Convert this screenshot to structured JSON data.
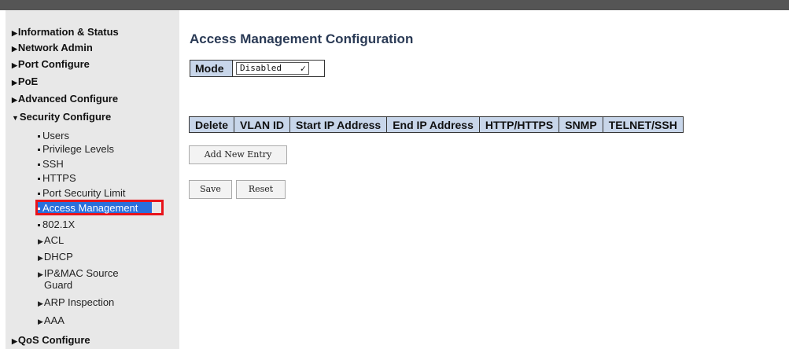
{
  "sidebar": {
    "top_items": [
      {
        "label": "Information & Status"
      },
      {
        "label": "Network Admin"
      },
      {
        "label": "Port Configure"
      },
      {
        "label": "PoE"
      },
      {
        "label": "Advanced Configure"
      }
    ],
    "security": {
      "label": "Security Configure",
      "sub_items": [
        {
          "label": "Users"
        },
        {
          "label": "Privilege Levels"
        },
        {
          "label": "SSH"
        },
        {
          "label": "HTTPS"
        },
        {
          "label": "Port Security Limit"
        },
        {
          "label": "Access Management"
        },
        {
          "label": "802.1X"
        },
        {
          "label": "ACL"
        },
        {
          "label": "DHCP"
        },
        {
          "label": "IP&MAC Source"
        },
        {
          "label": "Guard"
        },
        {
          "label": "ARP Inspection"
        },
        {
          "label": "AAA"
        }
      ]
    },
    "bottom_item": {
      "label": "QoS Configure"
    }
  },
  "main": {
    "title": "Access Management Configuration",
    "mode_label": "Mode",
    "mode_value": "Disabled",
    "table_headers": [
      "Delete",
      "VLAN ID",
      "Start IP Address",
      "End IP Address",
      "HTTP/HTTPS",
      "SNMP",
      "TELNET/SSH"
    ],
    "add_button": "Add New Entry",
    "save_button": "Save",
    "reset_button": "Reset"
  },
  "colors": {
    "header_bg": "#c8d6ea",
    "active_highlight": "#2a6fdb",
    "active_border": "#e8141b",
    "topbar": "#555555",
    "sidebar_bg": "#e8e8e8"
  }
}
